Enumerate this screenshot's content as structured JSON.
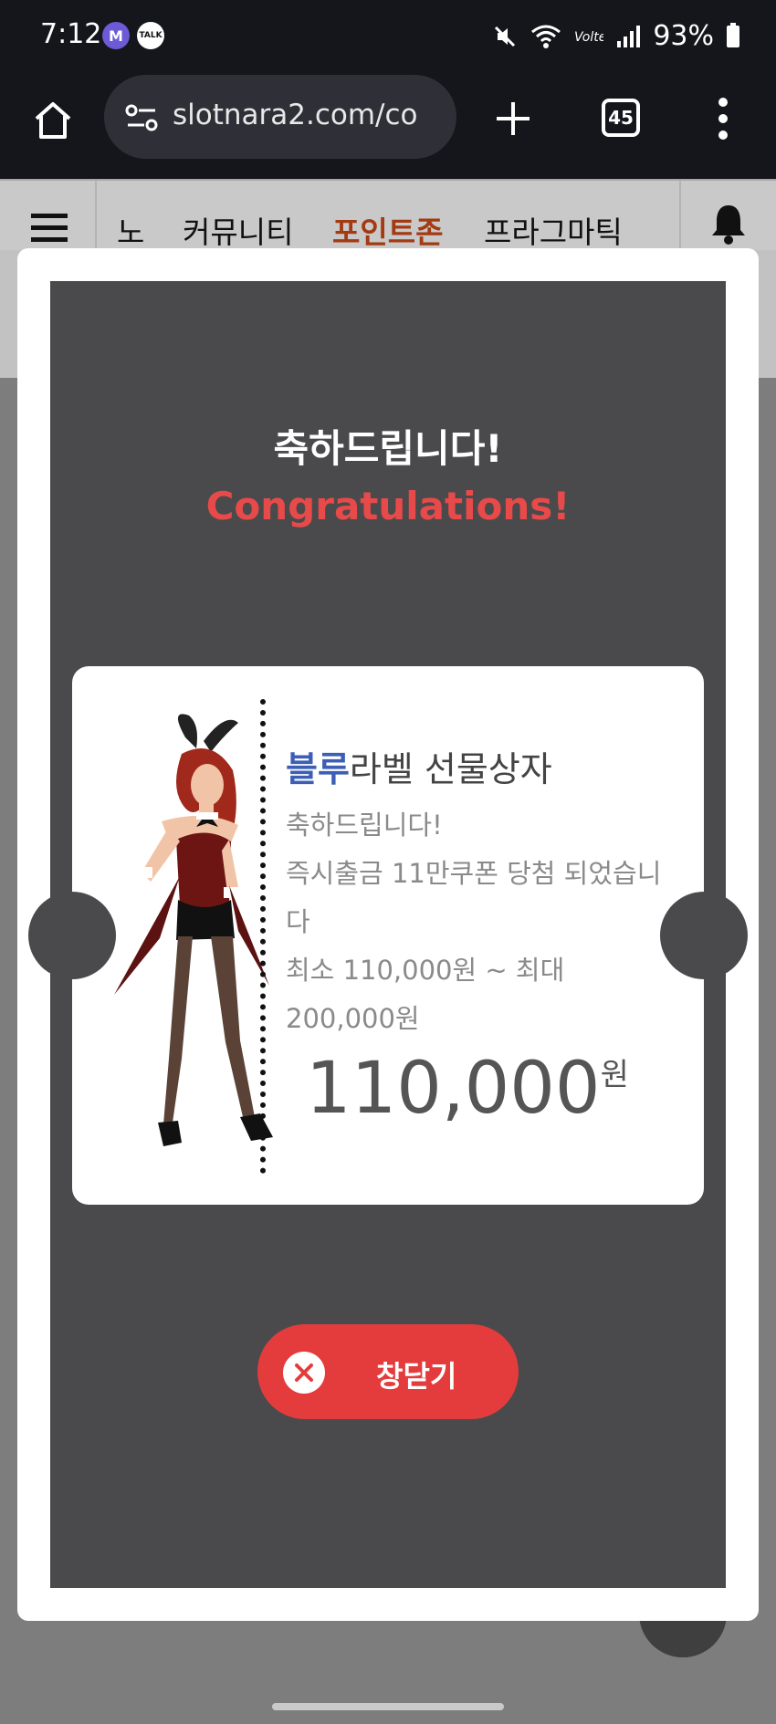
{
  "status_bar": {
    "time": "7:12",
    "notif_m": "M",
    "notif_talk": "TALK",
    "battery": "93%",
    "icons": [
      "mute-icon",
      "wifi-icon",
      "volte-icon",
      "signal-icon",
      "battery-icon"
    ]
  },
  "browser": {
    "url": "slotnara2.com/co",
    "tab_count": "45"
  },
  "site_nav": {
    "items": [
      {
        "label": "노"
      },
      {
        "label": "커뮤니티"
      },
      {
        "label": "포인트존"
      },
      {
        "label": "프라그마틱"
      }
    ],
    "active_item": "포인트존",
    "active_color": "#a33a12"
  },
  "modal": {
    "title_ko": "축하드립니다!",
    "title_en": "Congratulations!",
    "prize": {
      "title_accent": "블루",
      "title_rest": "라벨 선물상자",
      "line1": "축하드립니다!",
      "line2": "즉시출금 11만쿠폰 당첨 되었습니다",
      "line3": "최소 110,000원 ~ 최대 200,000원",
      "amount": "110,000",
      "amount_unit": "원"
    },
    "close_label": "창닫기"
  },
  "colors": {
    "accent_blue": "#3c5fb5",
    "congrats_red": "#e84a4a",
    "close_button": "#e43c3c",
    "modal_bg": "#4a4a4c"
  }
}
